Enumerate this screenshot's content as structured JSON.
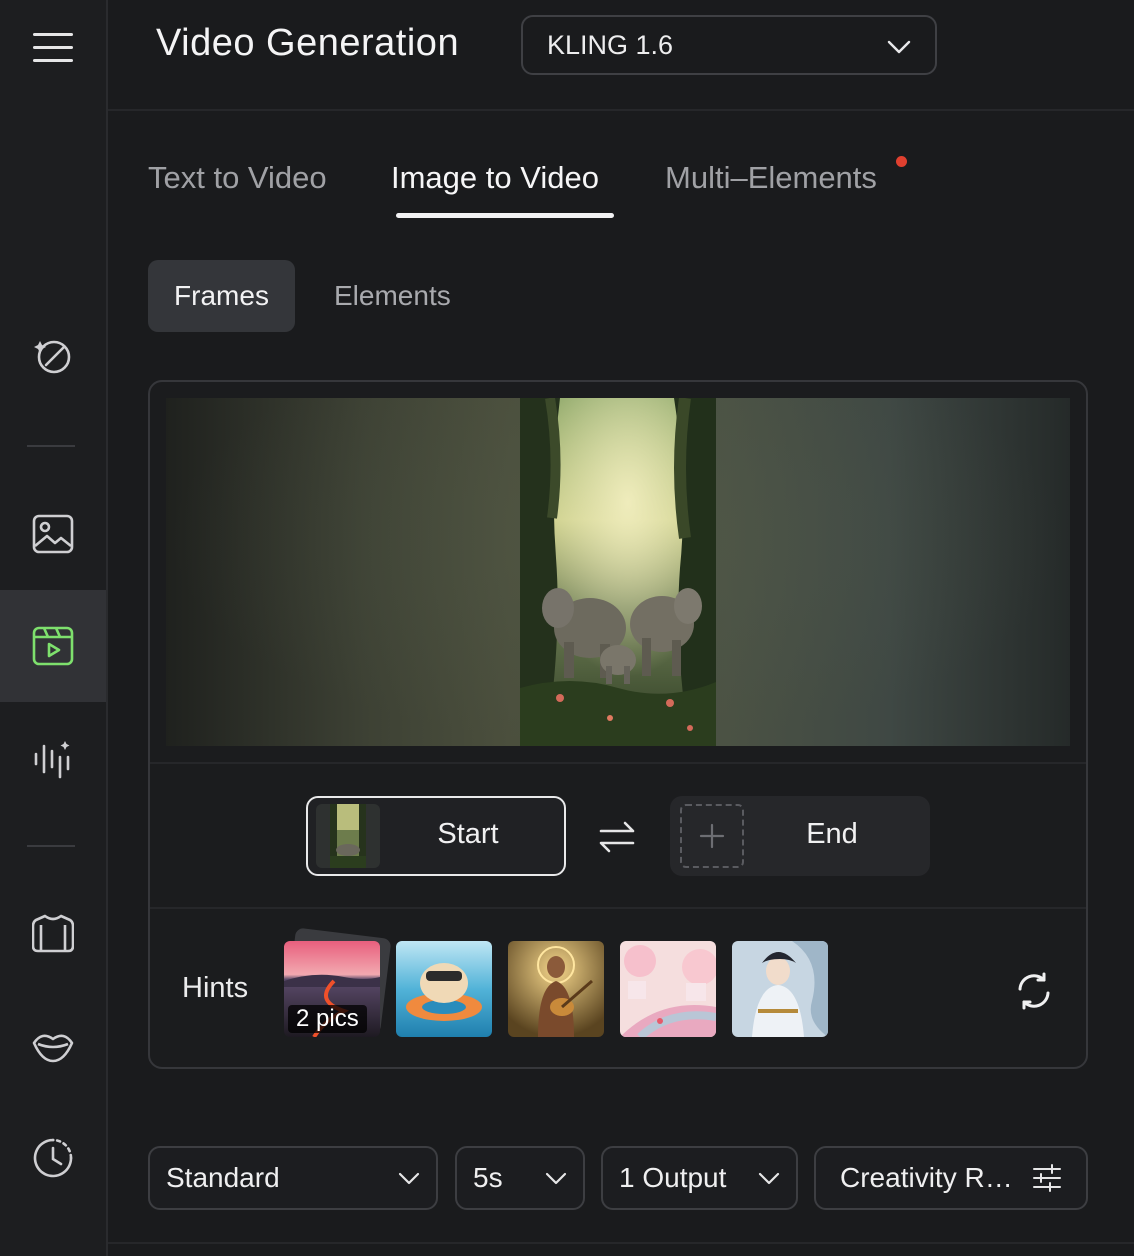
{
  "header": {
    "title": "Video Generation",
    "model_value": "KLING 1.6"
  },
  "tabs": [
    "Text to Video",
    "Image to Video",
    "Multi–Elements"
  ],
  "subtabs": [
    "Frames",
    "Elements"
  ],
  "frames": {
    "start_label": "Start",
    "end_label": "End"
  },
  "hints": {
    "label": "Hints",
    "stack_count": "2 pics"
  },
  "options": {
    "quality": "Standard",
    "duration": "5s",
    "outputs": "1 Output",
    "creativity": "Creativity R…"
  },
  "colors": {
    "active_icon": "#7ee06d",
    "notification_dot": "#e0402f"
  }
}
